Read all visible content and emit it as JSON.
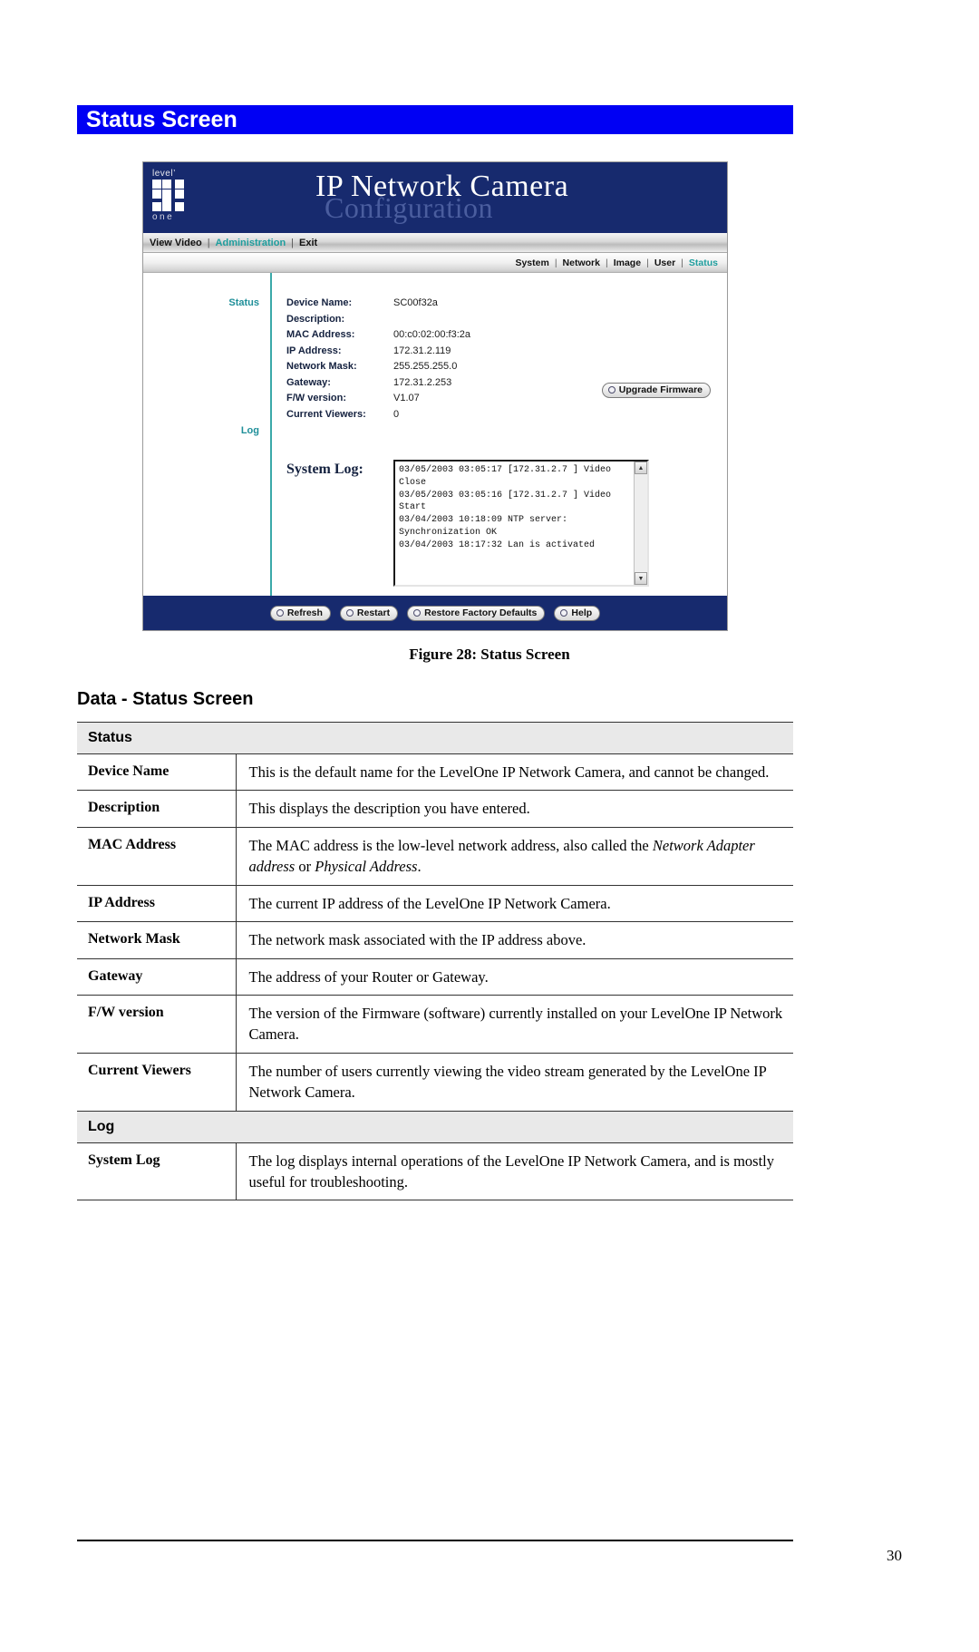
{
  "page": {
    "heading": "Status Screen",
    "figure_caption": "Figure 28: Status Screen",
    "section_title": "Data - Status Screen",
    "page_number": "30",
    "banner_color": "#0000f4"
  },
  "camera_ui": {
    "logo": {
      "top_word": "level’",
      "bottom_word": "one"
    },
    "title": "IP Network Camera",
    "subtitle": "Configuration",
    "header_color": "#172a6e",
    "accent_color": "#1f9e9e",
    "primary_nav": [
      {
        "label": "View Video",
        "active": false
      },
      {
        "label": "Administration",
        "active": true
      },
      {
        "label": "Exit",
        "active": false
      }
    ],
    "nav_separator": "|",
    "secondary_nav": [
      {
        "label": "System",
        "active": false
      },
      {
        "label": "Network",
        "active": false
      },
      {
        "label": "Image",
        "active": false
      },
      {
        "label": "User",
        "active": false
      },
      {
        "label": "Status",
        "active": true
      }
    ],
    "side_labels": {
      "status": "Status",
      "log": "Log"
    },
    "fields": [
      {
        "label": "Device Name:",
        "value": "SC00f32a"
      },
      {
        "label": "Description:",
        "value": ""
      },
      {
        "label": "MAC Address:",
        "value": "00:c0:02:00:f3:2a"
      },
      {
        "label": "IP Address:",
        "value": "172.31.2.119"
      },
      {
        "label": "Network Mask:",
        "value": "255.255.255.0"
      },
      {
        "label": "Gateway:",
        "value": "172.31.2.253"
      },
      {
        "label": "F/W version:",
        "value": "V1.07"
      },
      {
        "label": "Current Viewers:",
        "value": "0"
      }
    ],
    "upgrade_button": "Upgrade Firmware",
    "system_log_label": "System Log:",
    "system_log_text": "03/05/2003 03:05:17 [172.31.2.7 ] Video Close\n03/05/2003 03:05:16 [172.31.2.7 ] Video Start\n03/04/2003 10:18:09 NTP server: Synchronization OK\n03/04/2003 18:17:32 Lan is activated",
    "footer_buttons": [
      "Refresh",
      "Restart",
      "Restore Factory Defaults",
      "Help"
    ],
    "scroll_up_glyph": "▲",
    "scroll_down_glyph": "▼"
  },
  "data_table": {
    "groups": [
      {
        "title": "Status",
        "rows": [
          {
            "term": "Device Name",
            "desc_parts": [
              {
                "text": "This is the default name for the LevelOne IP Network Camera, and cannot be changed.",
                "italic": false
              }
            ]
          },
          {
            "term": "Description",
            "desc_parts": [
              {
                "text": "This displays the description you have entered.",
                "italic": false
              }
            ]
          },
          {
            "term": "MAC Address",
            "desc_parts": [
              {
                "text": "The MAC address is the low-level network address, also called the ",
                "italic": false
              },
              {
                "text": "Network Adapter address",
                "italic": true
              },
              {
                "text": " or ",
                "italic": false
              },
              {
                "text": "Physical Address",
                "italic": true
              },
              {
                "text": ".",
                "italic": false
              }
            ]
          },
          {
            "term": "IP Address",
            "desc_parts": [
              {
                "text": "The current IP address of the LevelOne IP Network Camera.",
                "italic": false
              }
            ]
          },
          {
            "term": "Network Mask",
            "desc_parts": [
              {
                "text": "The network mask associated with the IP address above.",
                "italic": false
              }
            ]
          },
          {
            "term": "Gateway",
            "desc_parts": [
              {
                "text": "The address of your Router or Gateway.",
                "italic": false
              }
            ]
          },
          {
            "term": "F/W version",
            "desc_parts": [
              {
                "text": "The version of the Firmware (software) currently installed on your LevelOne IP Network Camera.",
                "italic": false
              }
            ]
          },
          {
            "term": "Current Viewers",
            "desc_parts": [
              {
                "text": "The number of users currently viewing the video stream generated by the LevelOne IP Network Camera.",
                "italic": false
              }
            ]
          }
        ]
      },
      {
        "title": "Log",
        "rows": [
          {
            "term": "System Log",
            "desc_parts": [
              {
                "text": "The log displays internal operations of the LevelOne IP Network Camera, and is mostly useful for troubleshooting.",
                "italic": false
              }
            ]
          }
        ]
      }
    ]
  }
}
